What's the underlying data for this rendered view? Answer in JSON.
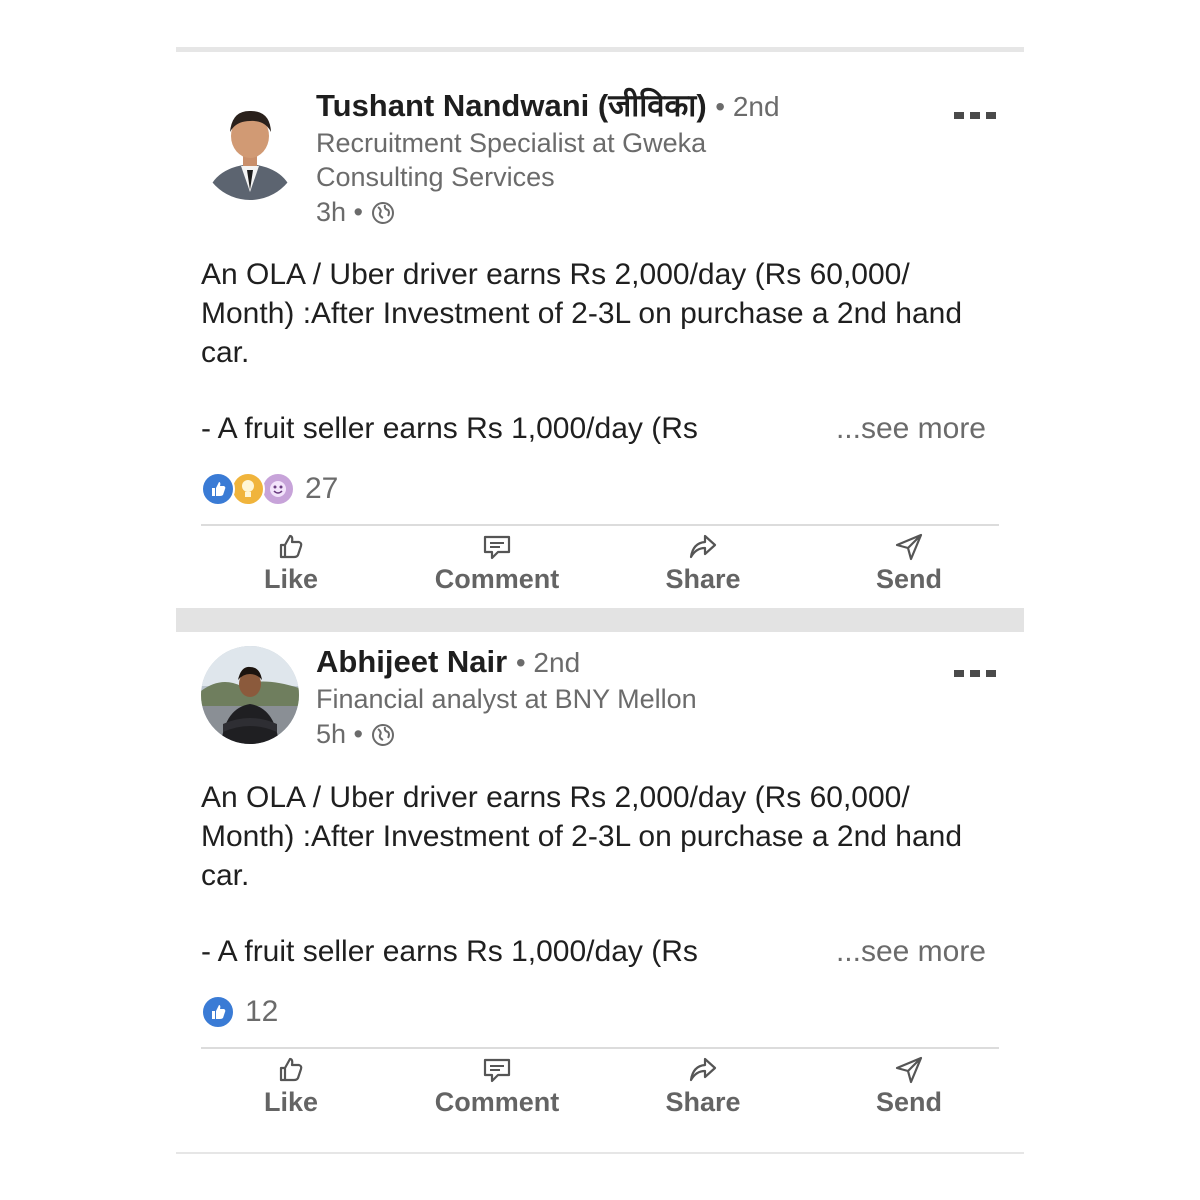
{
  "posts": [
    {
      "author": "Tushant Nandwani (जीविका)",
      "degree": "• 2nd",
      "headline": "Recruitment Specialist at Gweka Consulting Services",
      "time": "3h •",
      "body": "An OLA / Uber driver earns Rs 2,000/day (Rs 60,000/ Month) :After Investment of 2-3L on purchase a 2nd hand car.",
      "teaser": "- A fruit seller earns Rs 1,000/day (Rs",
      "see_more": "...see more",
      "reaction_count": "27",
      "reaction_icons": [
        "like-reaction-icon",
        "insightful-reaction-icon",
        "funny-reaction-icon"
      ]
    },
    {
      "author": "Abhijeet Nair",
      "degree": "• 2nd",
      "headline": "Financial analyst at BNY Mellon",
      "time": "5h •",
      "body": "An OLA / Uber driver earns Rs 2,000/day (Rs 60,000/ Month) :After Investment of 2-3L on purchase a 2nd hand car.",
      "teaser": "- A fruit seller earns Rs 1,000/day (Rs",
      "see_more": "...see more",
      "reaction_count": "12",
      "reaction_icons": [
        "like-reaction-icon"
      ]
    }
  ],
  "actions": {
    "like": "Like",
    "comment": "Comment",
    "share": "Share",
    "send": "Send"
  },
  "colors": {
    "like_blue": "#3a7bd5",
    "insightful_yellow": "#f0b43c",
    "funny_purple": "#c7a3d9",
    "secondary_text": "#6b6b6b"
  }
}
